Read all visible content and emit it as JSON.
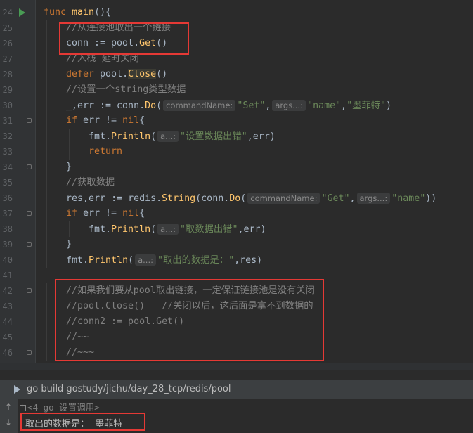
{
  "editor": {
    "lines": [
      {
        "n": "24",
        "indent": 0,
        "tokens": [
          [
            "kw",
            "func "
          ],
          [
            "fn",
            "main"
          ],
          [
            "tx",
            "(){"
          ]
        ]
      },
      {
        "n": "25",
        "indent": 1,
        "tokens": [
          [
            "cm",
            "//从连接池取出一个链接"
          ]
        ]
      },
      {
        "n": "26",
        "indent": 1,
        "tokens": [
          [
            "tx",
            "conn := pool."
          ],
          [
            "mt",
            "Get"
          ],
          [
            "tx",
            "()"
          ]
        ]
      },
      {
        "n": "27",
        "indent": 1,
        "tokens": [
          [
            "cm",
            "//入栈 延时关闭"
          ]
        ]
      },
      {
        "n": "28",
        "indent": 1,
        "tokens": [
          [
            "kw",
            "defer "
          ],
          [
            "tx",
            "pool."
          ],
          [
            "mthl",
            "Close"
          ],
          [
            "tx",
            "()"
          ]
        ]
      },
      {
        "n": "29",
        "indent": 1,
        "tokens": [
          [
            "cm",
            "//设置一个string类型数据"
          ]
        ]
      },
      {
        "n": "30",
        "indent": 1,
        "tokens": [
          [
            "tx",
            "_,err := conn."
          ],
          [
            "mt",
            "Do"
          ],
          [
            "tx",
            "("
          ],
          [
            "hint",
            "commandName:"
          ],
          [
            "st",
            "\"Set\""
          ],
          [
            "tx",
            ","
          ],
          [
            "hint",
            "args...:"
          ],
          [
            "st",
            "\"name\""
          ],
          [
            "tx",
            ","
          ],
          [
            "st",
            "\"墨菲特\""
          ],
          [
            "tx",
            ")"
          ]
        ]
      },
      {
        "n": "31",
        "indent": 1,
        "tokens": [
          [
            "kw",
            "if "
          ],
          [
            "tx",
            "err != "
          ],
          [
            "kw",
            "nil"
          ],
          [
            "tx",
            "{"
          ]
        ]
      },
      {
        "n": "32",
        "indent": 2,
        "tokens": [
          [
            "tx",
            "fmt."
          ],
          [
            "mt",
            "Println"
          ],
          [
            "tx",
            "("
          ],
          [
            "hint",
            "a...:"
          ],
          [
            "st",
            "\"设置数据出错\""
          ],
          [
            "tx",
            ",err)"
          ]
        ]
      },
      {
        "n": "33",
        "indent": 2,
        "tokens": [
          [
            "kw",
            "return"
          ]
        ]
      },
      {
        "n": "34",
        "indent": 1,
        "tokens": [
          [
            "tx",
            "}"
          ]
        ]
      },
      {
        "n": "35",
        "indent": 1,
        "tokens": [
          [
            "cm",
            "//获取数据"
          ]
        ]
      },
      {
        "n": "36",
        "indent": 1,
        "tokens": [
          [
            "tx",
            "res,"
          ],
          [
            "ul",
            "err"
          ],
          [
            "tx",
            " := redis."
          ],
          [
            "mt",
            "String"
          ],
          [
            "tx",
            "(conn."
          ],
          [
            "mt",
            "Do"
          ],
          [
            "tx",
            "("
          ],
          [
            "hint",
            "commandName:"
          ],
          [
            "st",
            "\"Get\""
          ],
          [
            "tx",
            ","
          ],
          [
            "hint",
            "args...:"
          ],
          [
            "st",
            "\"name\""
          ],
          [
            "tx",
            "))"
          ]
        ]
      },
      {
        "n": "37",
        "indent": 1,
        "tokens": [
          [
            "kw",
            "if "
          ],
          [
            "tx",
            "err != "
          ],
          [
            "kw",
            "nil"
          ],
          [
            "tx",
            "{"
          ]
        ]
      },
      {
        "n": "38",
        "indent": 2,
        "tokens": [
          [
            "tx",
            "fmt."
          ],
          [
            "mt",
            "Println"
          ],
          [
            "tx",
            "("
          ],
          [
            "hint",
            "a...:"
          ],
          [
            "st",
            "\"取数据出错\""
          ],
          [
            "tx",
            ",err)"
          ]
        ]
      },
      {
        "n": "39",
        "indent": 1,
        "tokens": [
          [
            "tx",
            "}"
          ]
        ]
      },
      {
        "n": "40",
        "indent": 1,
        "tokens": [
          [
            "tx",
            "fmt."
          ],
          [
            "mt",
            "Println"
          ],
          [
            "tx",
            "("
          ],
          [
            "hint",
            "a...:"
          ],
          [
            "st",
            "\"取出的数据是：\""
          ],
          [
            "tx",
            ",res)"
          ]
        ]
      },
      {
        "n": "41",
        "indent": 0,
        "tokens": []
      },
      {
        "n": "42",
        "indent": 1,
        "tokens": [
          [
            "cm",
            "//如果我们要从pool取出链接，一定保证链接池是没有关闭"
          ]
        ]
      },
      {
        "n": "43",
        "indent": 1,
        "tokens": [
          [
            "cm",
            "//pool.Close()   //关闭以后，这后面是拿不到数据的"
          ]
        ]
      },
      {
        "n": "44",
        "indent": 1,
        "tokens": [
          [
            "cm",
            "//conn2 := pool.Get()"
          ]
        ]
      },
      {
        "n": "45",
        "indent": 1,
        "tokens": [
          [
            "cm",
            "//~~"
          ]
        ]
      },
      {
        "n": "46",
        "indent": 1,
        "tokens": [
          [
            "cm",
            "//~~~"
          ]
        ]
      }
    ]
  },
  "run_panel": {
    "config_label": "go build gostudy/jichu/day_28_tcp/redis/pool",
    "collapsed_line": "<4 go 设置调用>",
    "output_line": "取出的数据是：  墨菲特"
  },
  "colors": {
    "background": "#2b2b2b",
    "keyword": "#cc7832",
    "function": "#ffc66d",
    "comment": "#808080",
    "string": "#6a8759",
    "annotation_box": "#e53935"
  }
}
